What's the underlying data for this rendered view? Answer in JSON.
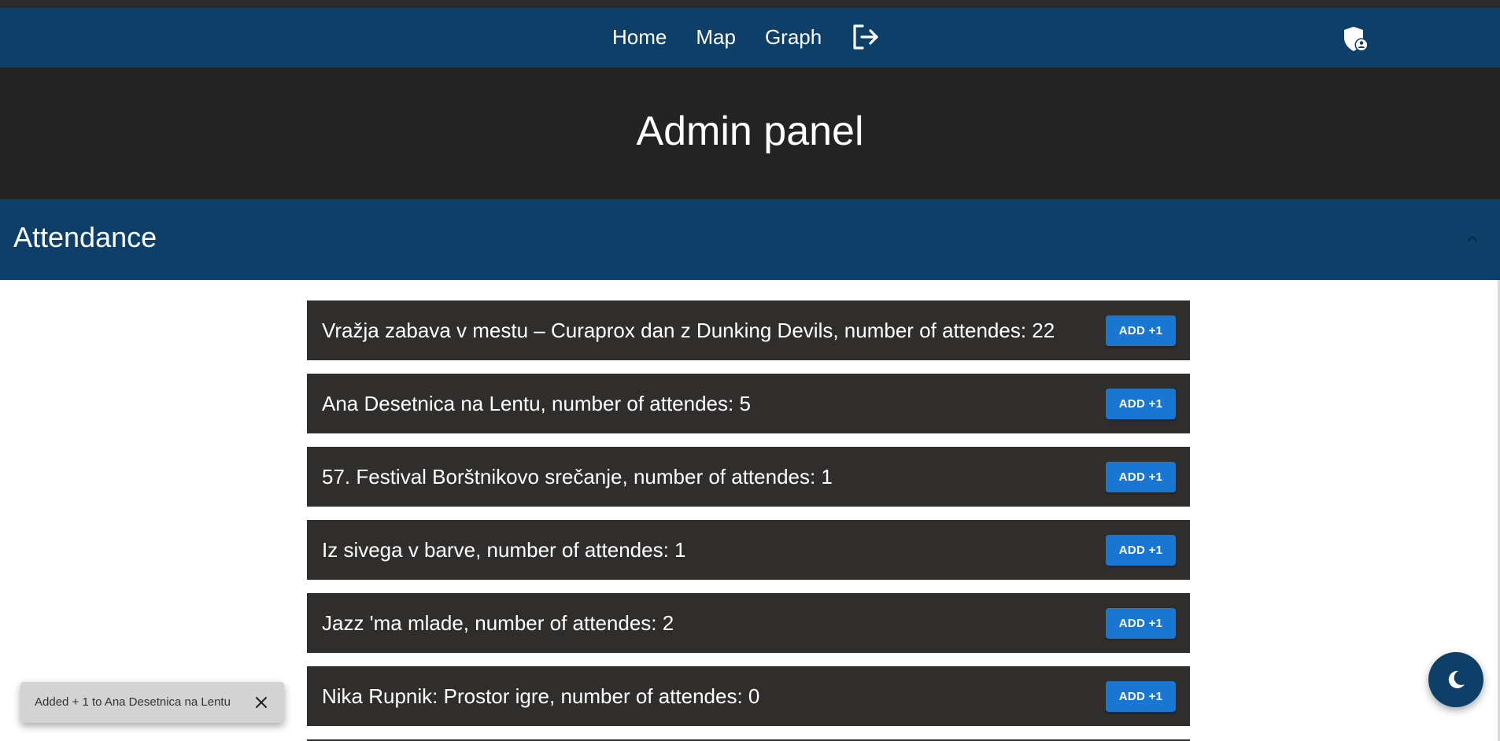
{
  "nav": {
    "links": [
      "Home",
      "Map",
      "Graph"
    ],
    "logout_icon": "logout-icon",
    "admin_icon": "admin-shield-icon"
  },
  "hero": {
    "title": "Admin panel"
  },
  "section": {
    "title": "Attendance",
    "expand_icon": "chevron-up-icon"
  },
  "attendance": {
    "button_label": "ADD +1",
    "rows": [
      "Vražja zabava v mestu – Curaprox dan z Dunking Devils, number of attendes: 22",
      "Ana Desetnica na Lentu, number of attendes: 5",
      "57. Festival Borštnikovo srečanje, number of attendes: 1",
      "Iz sivega v barve, number of attendes: 1",
      "Jazz 'ma mlade, number of attendes: 2",
      "Nika Rupnik: Prostor igre, number of attendes: 0"
    ]
  },
  "snackbar": {
    "message": "Added + 1 to Ana Desetnica na Lentu",
    "close_icon": "close-icon"
  },
  "fab": {
    "icon": "moon-icon"
  },
  "colors": {
    "primary": "#0d3f69",
    "hero_bg": "#232323",
    "row_bg": "#302e2d",
    "button": "#1976d2"
  }
}
